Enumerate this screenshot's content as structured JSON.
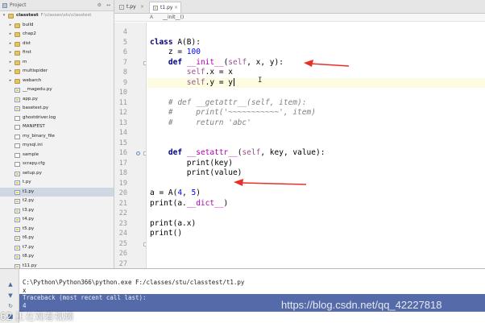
{
  "project": {
    "header_label": "Project",
    "tree": [
      {
        "label": "classtest",
        "path": "F:\\classes\\stu\\classtest",
        "type": "folder",
        "depth": 0,
        "expanded": true,
        "root": true
      },
      {
        "label": "build",
        "type": "folder",
        "depth": 1
      },
      {
        "label": "chap2",
        "type": "folder",
        "depth": 1
      },
      {
        "label": "dist",
        "type": "folder",
        "depth": 1
      },
      {
        "label": "first",
        "type": "folder",
        "depth": 1
      },
      {
        "label": "m",
        "type": "folder",
        "depth": 1
      },
      {
        "label": "multispider",
        "type": "folder",
        "depth": 1
      },
      {
        "label": "webarch",
        "type": "folder",
        "depth": 1
      },
      {
        "label": "__magedu.py",
        "type": "py",
        "depth": 1
      },
      {
        "label": "app.py",
        "type": "py",
        "depth": 1
      },
      {
        "label": "basetest.py",
        "type": "py",
        "depth": 1
      },
      {
        "label": "ghostdriver.log",
        "type": "file",
        "depth": 1
      },
      {
        "label": "MANIFEST",
        "type": "file",
        "depth": 1
      },
      {
        "label": "my_binary_file",
        "type": "file",
        "depth": 1
      },
      {
        "label": "mysql.ini",
        "type": "file",
        "depth": 1
      },
      {
        "label": "sample",
        "type": "file",
        "depth": 1
      },
      {
        "label": "scrapy.cfg",
        "type": "file",
        "depth": 1
      },
      {
        "label": "setup.py",
        "type": "py",
        "depth": 1
      },
      {
        "label": "t.py",
        "type": "py",
        "depth": 1
      },
      {
        "label": "t1.py",
        "type": "py",
        "depth": 1,
        "selected": true
      },
      {
        "label": "t2.py",
        "type": "py",
        "depth": 1
      },
      {
        "label": "t3.py",
        "type": "py",
        "depth": 1
      },
      {
        "label": "t4.py",
        "type": "py",
        "depth": 1
      },
      {
        "label": "t5.py",
        "type": "py",
        "depth": 1
      },
      {
        "label": "t6.py",
        "type": "py",
        "depth": 1
      },
      {
        "label": "t7.py",
        "type": "py",
        "depth": 1
      },
      {
        "label": "t8.py",
        "type": "py",
        "depth": 1
      },
      {
        "label": "t11.py",
        "type": "py",
        "depth": 1
      }
    ]
  },
  "tabs": [
    {
      "label": "t.py",
      "icon": "python-file-icon",
      "active": false
    },
    {
      "label": "t1.py",
      "icon": "python-file-icon",
      "active": true
    }
  ],
  "breadcrumb": {
    "icon": "function-icon",
    "text": "__init__()"
  },
  "editor": {
    "first_line_number": 4,
    "current_line": 9,
    "colors": {
      "keyword": "#000080",
      "magic_method": "#b200b2",
      "number": "#0000ff",
      "comment": "#808080",
      "self": "#94558d",
      "current_line_bg": "#fdfbe0"
    },
    "lines": [
      "",
      "class A(B):",
      "    z = 100",
      "    def __init__(self, x, y):",
      "        self.x = x",
      "        self.y = y",
      "",
      "    # def __getattr__(self, item):",
      "    #     print('~~~~~~~~~~~', item)",
      "    #     return 'abc'",
      "",
      "",
      "    def __setattr__(self, key, value):",
      "        print(key)",
      "        print(value)",
      "",
      "a = A(4, 5)",
      "print(a.__dict__)",
      "",
      "print(a.x)",
      "print()",
      "",
      "",
      ""
    ]
  },
  "run": {
    "buttons": [
      "run-up-icon",
      "run-down-icon",
      "run-rerun-icon",
      "run-stop-icon"
    ],
    "output": [
      "C:\\Python\\Python366\\python.exe F:/classes/stu/classtest/t1.py",
      "x",
      "",
      "Traceback (most recent call last):",
      "4"
    ]
  },
  "overlays": {
    "watermark": "https://blog.csdn.net/qq_42227818",
    "viewer_banner": "62 正在观看视频"
  },
  "annotation_color": "#e8302a"
}
